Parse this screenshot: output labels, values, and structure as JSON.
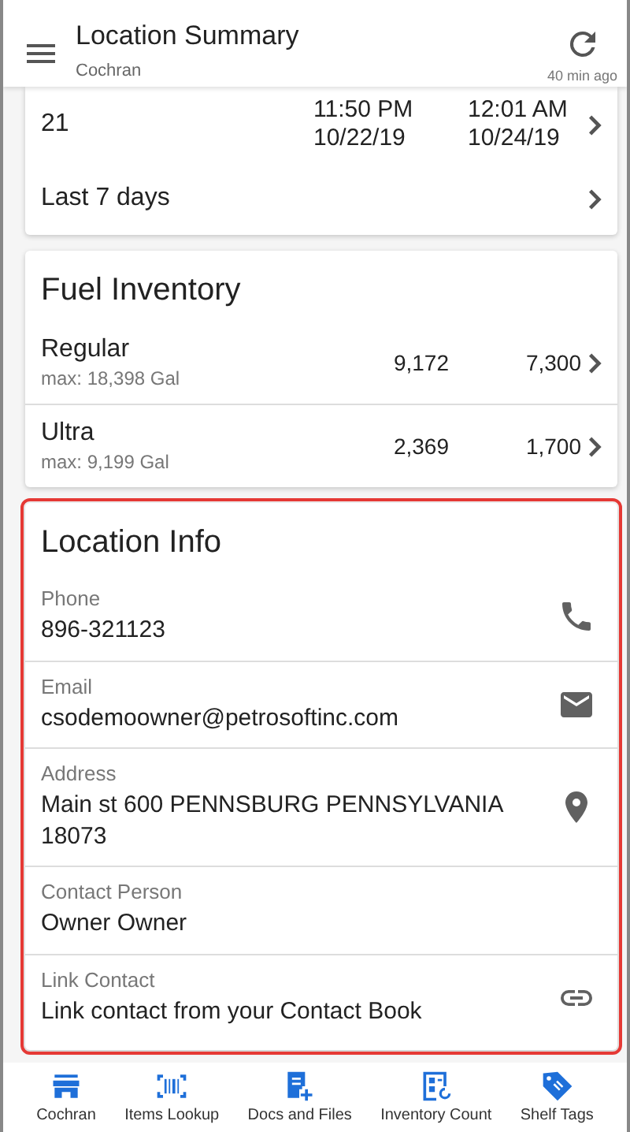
{
  "header": {
    "title": "Location Summary",
    "subtitle": "Cochran",
    "updated": "40 min ago"
  },
  "summary": {
    "rows": [
      {
        "kind": "times",
        "label": "21",
        "start_time": "11:50 PM",
        "start_date": "10/22/19",
        "end_time": "12:01 AM",
        "end_date": "10/24/19"
      },
      {
        "kind": "link",
        "label": "Last 7 days"
      }
    ]
  },
  "fuel": {
    "title": "Fuel Inventory",
    "rows": [
      {
        "name": "Regular",
        "max": "max: 18,398 Gal",
        "value_1": "9,172",
        "value_2": "7,300"
      },
      {
        "name": "Ultra",
        "max": "max: 9,199 Gal",
        "value_1": "2,369",
        "value_2": "1,700"
      }
    ]
  },
  "location_info": {
    "title": "Location Info",
    "highlighted": true,
    "fields": [
      {
        "label": "Phone",
        "value": "896-321123",
        "kind": "phone"
      },
      {
        "label": "Email",
        "value": "csodemoowner@petrosoftinc.com",
        "kind": "email"
      },
      {
        "label": "Address",
        "value": "Main st 600 PENNSBURG PENNSYLVANIA 18073",
        "kind": "address"
      },
      {
        "label": "Contact Person",
        "value": "Owner Owner",
        "kind": "text"
      },
      {
        "label": "Link Contact",
        "value": "Link contact from your Contact Book",
        "kind": "link"
      }
    ]
  },
  "bottom_nav": [
    {
      "label": "Cochran",
      "kind": "store"
    },
    {
      "label": "Items Lookup",
      "kind": "lookup"
    },
    {
      "label": "Docs and Files",
      "kind": "docs"
    },
    {
      "label": "Inventory Count",
      "kind": "count"
    },
    {
      "label": "Shelf Tags",
      "kind": "tags"
    }
  ]
}
